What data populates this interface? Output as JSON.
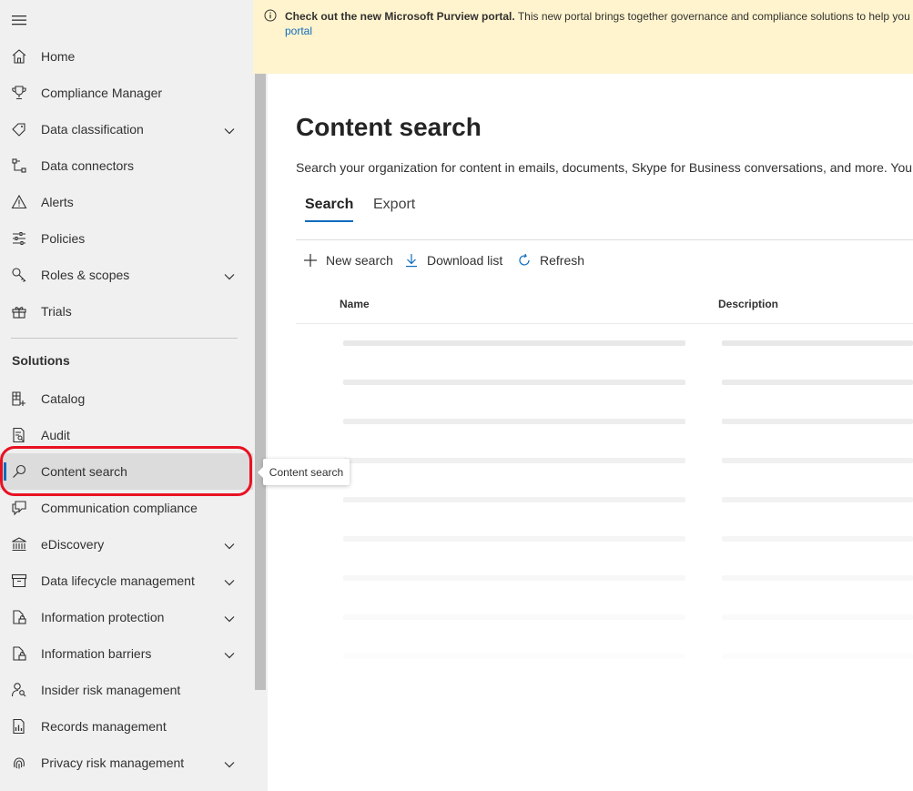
{
  "banner": {
    "title": "Check out the new Microsoft Purview portal.",
    "message": " This new portal brings together governance and compliance solutions to help you",
    "link_text": "portal"
  },
  "sidebar": {
    "items": [
      {
        "label": "Home",
        "icon": "home-icon",
        "chevron": false
      },
      {
        "label": "Compliance Manager",
        "icon": "trophy-icon",
        "chevron": false
      },
      {
        "label": "Data classification",
        "icon": "tag-icon",
        "chevron": true
      },
      {
        "label": "Data connectors",
        "icon": "connector-icon",
        "chevron": false
      },
      {
        "label": "Alerts",
        "icon": "warning-icon",
        "chevron": false
      },
      {
        "label": "Policies",
        "icon": "sliders-icon",
        "chevron": false
      },
      {
        "label": "Roles & scopes",
        "icon": "key-icon",
        "chevron": true
      },
      {
        "label": "Trials",
        "icon": "gift-icon",
        "chevron": false
      }
    ],
    "section_title": "Solutions",
    "solutions": [
      {
        "label": "Catalog",
        "icon": "grid-add-icon",
        "chevron": false
      },
      {
        "label": "Audit",
        "icon": "document-search-icon",
        "chevron": false
      },
      {
        "label": "Content search",
        "icon": "search-icon",
        "chevron": false,
        "active": true
      },
      {
        "label": "Communication compliance",
        "icon": "chat-icon",
        "chevron": false
      },
      {
        "label": "eDiscovery",
        "icon": "bank-icon",
        "chevron": true
      },
      {
        "label": "Data lifecycle management",
        "icon": "archive-icon",
        "chevron": true
      },
      {
        "label": "Information protection",
        "icon": "lock-document-icon",
        "chevron": true
      },
      {
        "label": "Information barriers",
        "icon": "lock-document-icon",
        "chevron": true
      },
      {
        "label": "Insider risk management",
        "icon": "person-search-icon",
        "chevron": false
      },
      {
        "label": "Records management",
        "icon": "records-icon",
        "chevron": false
      },
      {
        "label": "Privacy risk management",
        "icon": "fingerprint-icon",
        "chevron": true
      }
    ]
  },
  "main": {
    "title": "Content search",
    "description": "Search your organization for content in emails, documents, Skype for Business conversations, and more. You ca",
    "tabs": [
      {
        "label": "Search",
        "selected": true
      },
      {
        "label": "Export",
        "selected": false
      }
    ],
    "commands": [
      {
        "label": "New search",
        "icon": "plus-icon"
      },
      {
        "label": "Download list",
        "icon": "download-icon"
      },
      {
        "label": "Refresh",
        "icon": "refresh-icon"
      }
    ],
    "columns": [
      "Name",
      "Description"
    ],
    "loading_rows": 9
  },
  "tooltip": {
    "text": "Content search"
  },
  "colors": {
    "accent": "#0f6cbd",
    "banner_bg": "#fff4ce",
    "highlight": "#e81123",
    "sidebar_bg": "#f0f0f0"
  }
}
